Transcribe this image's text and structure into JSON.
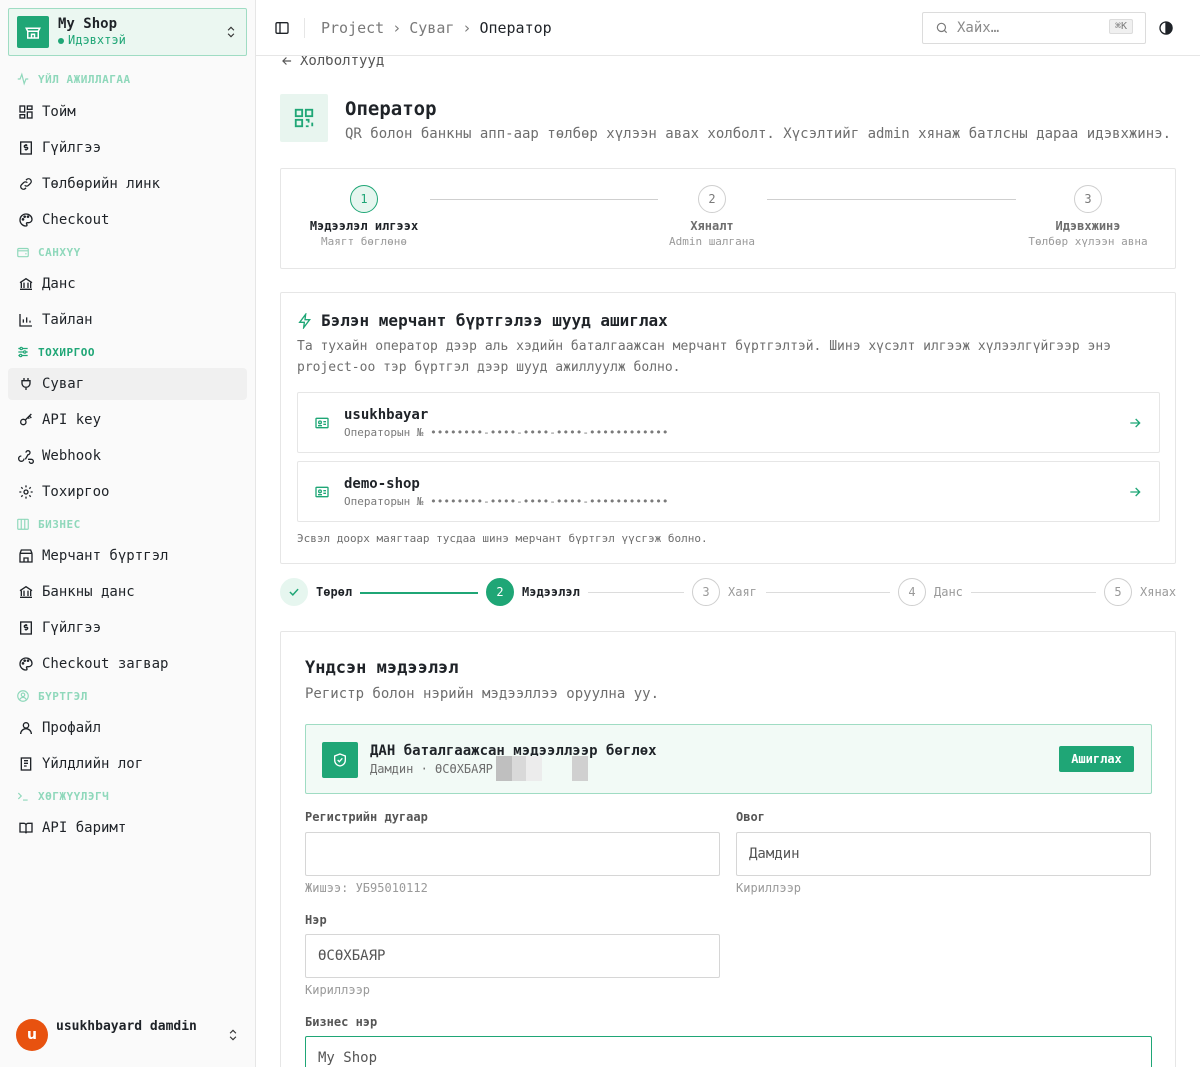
{
  "app": {
    "shop_name": "My Shop",
    "shop_status": "Идэвхтэй"
  },
  "sidebar": {
    "sections": [
      {
        "label": "ҮЙЛ АЖИЛЛАГАА",
        "icon": "activity-icon"
      },
      {
        "label": "САНХҮҮ",
        "icon": "wallet-icon"
      },
      {
        "label": "ТОХИРГОО",
        "icon": "sliders-icon"
      },
      {
        "label": "БИЗНЕС",
        "icon": "briefcase-icon"
      },
      {
        "label": "БҮРТГЭЛ",
        "icon": "user-circle-icon"
      },
      {
        "label": "ХӨГЖҮҮЛЭГЧ",
        "icon": "terminal-icon"
      }
    ],
    "items": [
      {
        "label": "Тойм",
        "icon": "dashboard-icon"
      },
      {
        "label": "Гүйлгээ",
        "icon": "dollar-receipt-icon"
      },
      {
        "label": "Төлбөрийн линк",
        "icon": "link-icon"
      },
      {
        "label": "Checkout",
        "icon": "palette-icon"
      },
      {
        "label": "Данс",
        "icon": "bank-icon"
      },
      {
        "label": "Тайлан",
        "icon": "chart-icon"
      },
      {
        "label": "Суваг",
        "icon": "plug-icon"
      },
      {
        "label": "API key",
        "icon": "key-icon"
      },
      {
        "label": "Webhook",
        "icon": "webhook-icon"
      },
      {
        "label": "Тохиргоо",
        "icon": "gear-icon"
      },
      {
        "label": "Мерчант бүртгэл",
        "icon": "store-icon"
      },
      {
        "label": "Банкны данс",
        "icon": "bank-icon"
      },
      {
        "label": "Гүйлгээ",
        "icon": "dollar-receipt-icon"
      },
      {
        "label": "Checkout загвар",
        "icon": "palette-icon"
      },
      {
        "label": "Профайл",
        "icon": "user-icon"
      },
      {
        "label": "Үйлдлийн лог",
        "icon": "log-icon"
      },
      {
        "label": "API баримт",
        "icon": "book-icon"
      }
    ],
    "user": {
      "initial": "u",
      "name": "usukhbayard damdin"
    }
  },
  "topbar": {
    "breadcrumb": [
      "Project",
      "Суваг",
      "Оператор"
    ],
    "search_placeholder": "Хайх…",
    "search_shortcut": "⌘K"
  },
  "page": {
    "back_label": "Холболтууд",
    "title": "Оператор",
    "description": "QR болон банкны апп-аар төлбөр хүлээн авах холболт. Хүсэлтийг admin хянаж батлсны дараа идэвхжинэ."
  },
  "steps": [
    {
      "num": "1",
      "label": "Мэдээлэл илгээх",
      "sub": "Маягт бөглөнө"
    },
    {
      "num": "2",
      "label": "Хяналт",
      "sub": "Admin шалгана"
    },
    {
      "num": "3",
      "label": "Идэвхжинэ",
      "sub": "Төлбөр хүлээн авна"
    }
  ],
  "merchant": {
    "title": "Бэлэн мерчант бүртгэлээ шууд ашиглах",
    "description": "Та тухайн оператор дээр аль хэдийн баталгаажсан мерчант бүртгэлтэй. Шинэ хүсэлт илгээж хүлээлгүйгээр энэ project-оо тэр бүртгэл дээр шууд ажиллуулж болно.",
    "rows": [
      {
        "name": "usukhbayar",
        "number": "Операторын № ••••••••-••••-••••-••••-••••••••••••"
      },
      {
        "name": "demo-shop",
        "number": "Операторын № ••••••••-••••-••••-••••-••••••••••••"
      }
    ],
    "footer": "Эсвэл доорх маягтаар тусдаа шинэ мерчант бүртгэл үүсгэж болно."
  },
  "wizard": [
    {
      "num": "",
      "label": "Төрөл",
      "state": "done"
    },
    {
      "num": "2",
      "label": "Мэдээлэл",
      "state": "current"
    },
    {
      "num": "3",
      "label": "Хаяг",
      "state": "todo"
    },
    {
      "num": "4",
      "label": "Данс",
      "state": "todo"
    },
    {
      "num": "5",
      "label": "Хянах",
      "state": "todo"
    }
  ],
  "form": {
    "title": "Үндсэн мэдээлэл",
    "description": "Регистр болон нэрийн мэдээллээ оруулна уу.",
    "dan": {
      "title": "ДАН баталгаажсан мэдээллээр бөглөх",
      "sub": "Дамдин · ӨСӨХБАЯР",
      "button": "Ашиглах"
    },
    "fields": {
      "register": {
        "label": "Регистрийн дугаар",
        "value": "",
        "hint": "Жишээ: УБ95010112"
      },
      "lastname": {
        "label": "Овог",
        "value": "Дамдин",
        "hint": "Кириллээр"
      },
      "firstname": {
        "label": "Нэр",
        "value": "ӨСӨХБАЯР",
        "hint": "Кириллээр"
      },
      "business": {
        "label": "Бизнес нэр",
        "value": "My Shop"
      }
    }
  },
  "colors": {
    "accent": "#1fa676",
    "accent_light": "#e6f6ef",
    "avatar": "#e8520f"
  }
}
